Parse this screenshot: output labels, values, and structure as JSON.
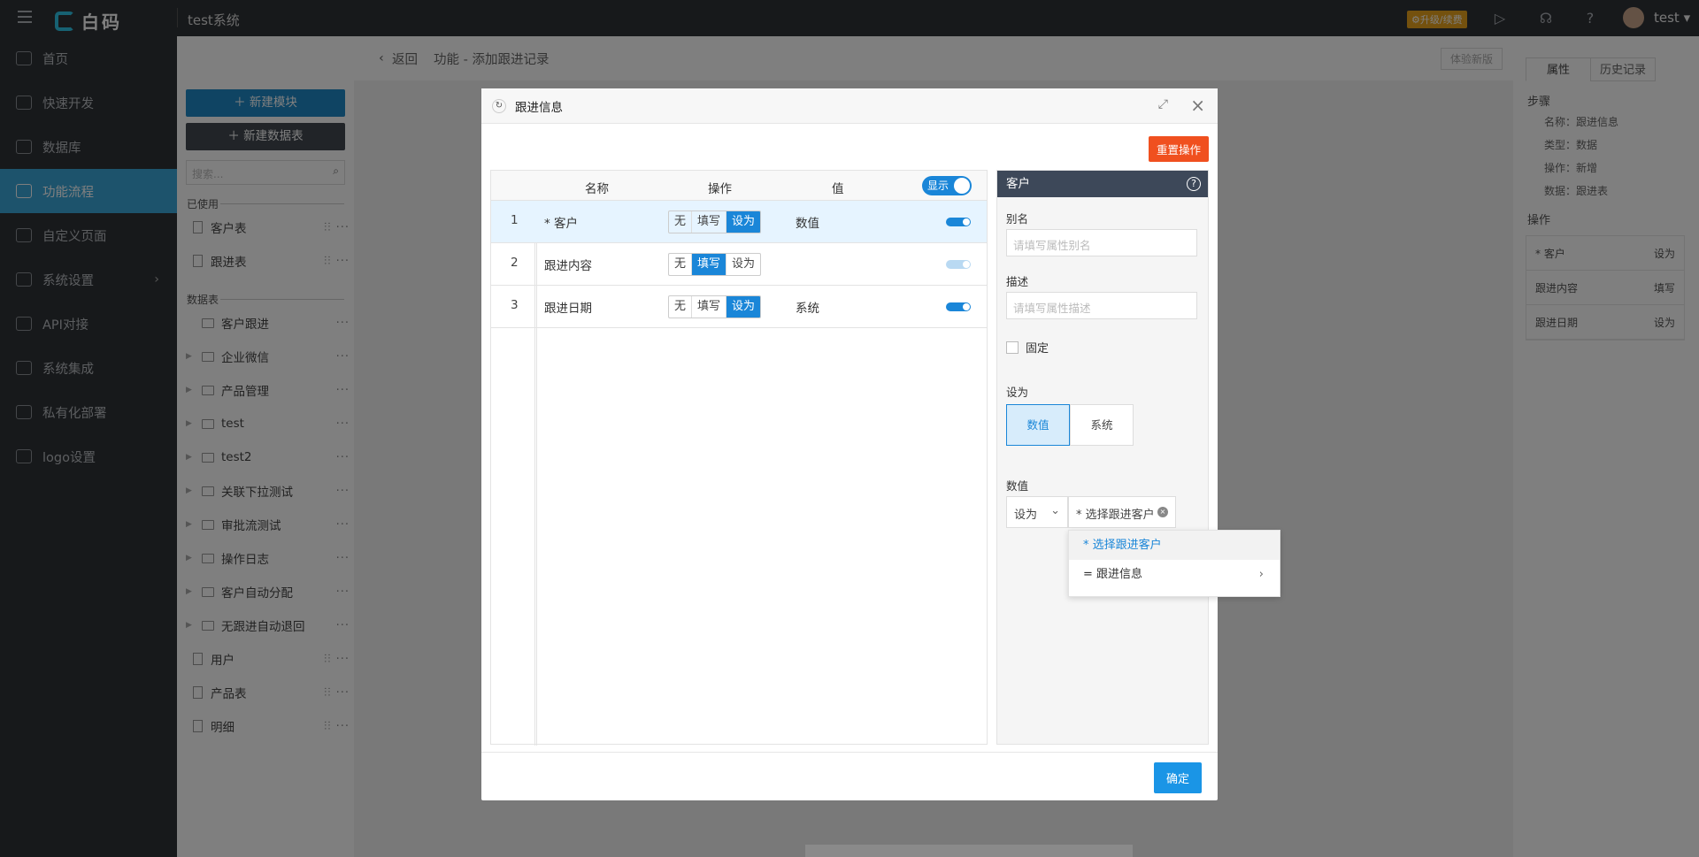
{
  "topbar": {
    "logo": "白码",
    "system": "test系统",
    "upgrade": "⚙升级/续费",
    "user": "test ▾"
  },
  "sidebar": {
    "items": [
      {
        "label": "首页"
      },
      {
        "label": "快速开发"
      },
      {
        "label": "数据库"
      },
      {
        "label": "功能流程",
        "active": true
      },
      {
        "label": "自定义页面"
      },
      {
        "label": "系统设置"
      },
      {
        "label": "API对接"
      },
      {
        "label": "系统集成"
      },
      {
        "label": "私有化部署"
      },
      {
        "label": "logo设置"
      }
    ]
  },
  "panel": {
    "new_module": "＋ 新建模块",
    "new_table": "＋ 新建数据表",
    "search_placeholder": "搜索...",
    "used_label": "已使用",
    "tables_label": "数据表",
    "used": [
      "客户表",
      "跟进表"
    ],
    "tables": [
      "客户跟进",
      "企业微信",
      "产品管理",
      "test",
      "test2",
      "关联下拉测试",
      "审批流测试",
      "操作日志",
      "客户自动分配",
      "无跟进自动退回",
      "用户",
      "产品表",
      "明细"
    ]
  },
  "content": {
    "back": "返回",
    "title": "功能 - 添加跟进记录",
    "version_btn": "体验新版"
  },
  "right": {
    "tab1": "属性",
    "tab2": "历史记录",
    "steps_label": "步骤",
    "name": "名称：跟进信息",
    "type": "类型：数据",
    "op": "操作：新增",
    "data": "数据：跟进表",
    "ops_label": "操作",
    "ops": [
      {
        "k": "* 客户",
        "v": "设为"
      },
      {
        "k": "跟进内容",
        "v": "填写"
      },
      {
        "k": "跟进日期",
        "v": "设为"
      }
    ]
  },
  "modal": {
    "title": "跟进信息",
    "reset": "重置操作",
    "confirm": "确定",
    "headers": {
      "name": "名称",
      "op": "操作",
      "val": "值",
      "show": "显示"
    },
    "rows": [
      {
        "n": "1",
        "name": "* 客户",
        "ops": [
          "无",
          "填写",
          "设为"
        ],
        "value": "数值"
      },
      {
        "n": "2",
        "name": "跟进内容",
        "ops": [
          "无",
          "填写",
          "设为"
        ],
        "value": ""
      },
      {
        "n": "3",
        "name": "跟进日期",
        "ops": [
          "无",
          "填写",
          "设为"
        ],
        "value": "系统"
      }
    ],
    "prop": {
      "title": "客户",
      "alias_label": "别名",
      "alias_ph": "请填写属性别名",
      "desc_label": "描述",
      "desc_ph": "请填写属性描述",
      "fixed": "固定",
      "setas_label": "设为",
      "card1": "数值",
      "card2": "系统",
      "value_label": "数值",
      "sel1": "设为",
      "sel2": "* 选择跟进客户"
    },
    "dropdown": [
      "* 选择跟进客户",
      "= 跟进信息"
    ]
  }
}
